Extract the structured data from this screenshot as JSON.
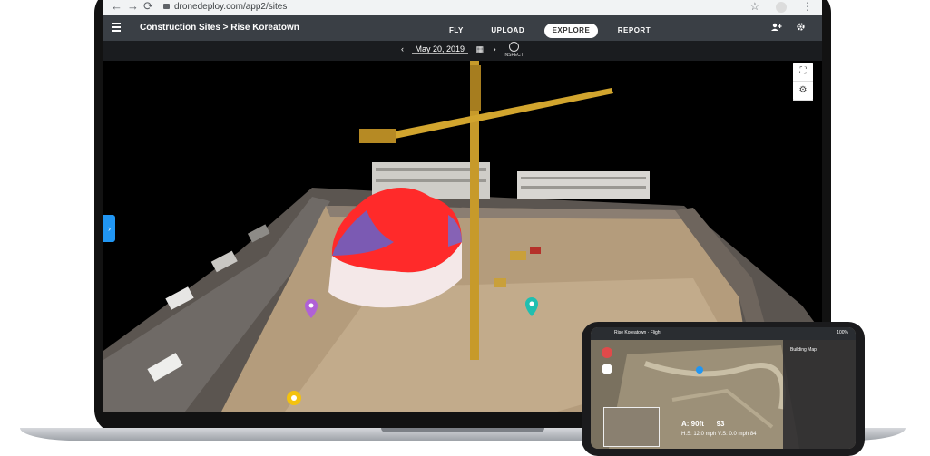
{
  "browser": {
    "back": "←",
    "forward": "→",
    "reload": "⟳",
    "url": "dronedeploy.com/app2/sites",
    "star": "☆",
    "menu": "⋮"
  },
  "header": {
    "breadcrumb": "Construction Sites > Rise Koreatown",
    "tabs": [
      {
        "label": "FLY",
        "active": false
      },
      {
        "label": "UPLOAD",
        "active": false
      },
      {
        "label": "EXPLORE",
        "active": true
      },
      {
        "label": "REPORT",
        "active": false
      }
    ]
  },
  "datebar": {
    "prev": "‹",
    "date": "May 20, 2019",
    "calendar": "▦",
    "next": "›",
    "inspect_label": "INSPECT"
  },
  "scene": {
    "side_tab": "›",
    "tools": [
      "⛶",
      "⚙"
    ]
  },
  "phone": {
    "top_left": "Rise Koreatown · Flight",
    "top_right": "100%",
    "side_title": "Building Map",
    "stats_line1_a": "A: 90ft",
    "stats_line1_b": "93",
    "stats_line2": "H.S: 12.0 mph   V.S: 0.0 mph   84"
  },
  "colors": {
    "header_bg": "#3a3f45",
    "accent_blue": "#2196f3",
    "stockpile_red": "#ff2a2a",
    "pin_purple": "#b061d6",
    "pin_teal": "#20bfb0",
    "pin_yellow": "#f3c20f"
  }
}
